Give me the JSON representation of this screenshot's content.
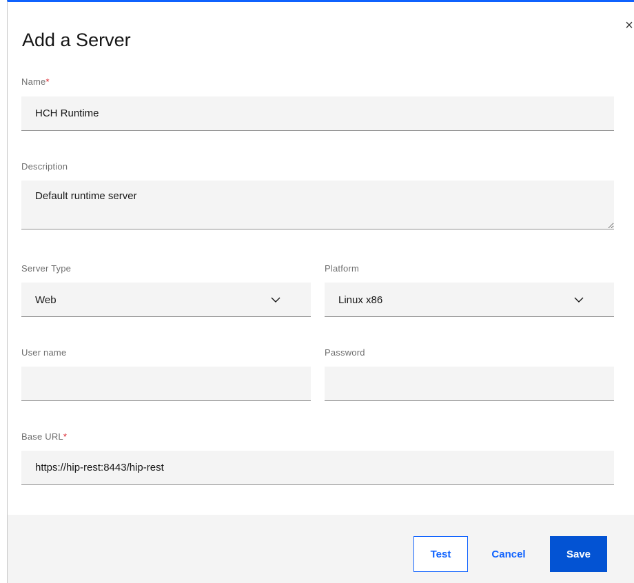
{
  "dialog": {
    "title": "Add a Server",
    "close_glyph": "×"
  },
  "fields": {
    "name": {
      "label": "Name",
      "required_mark": "*",
      "value": "HCH Runtime"
    },
    "description": {
      "label": "Description",
      "value": "Default runtime server"
    },
    "server_type": {
      "label": "Server Type",
      "value": "Web"
    },
    "platform": {
      "label": "Platform",
      "value": "Linux x86"
    },
    "username": {
      "label": "User name",
      "value": ""
    },
    "password": {
      "label": "Password",
      "value": ""
    },
    "base_url": {
      "label": "Base URL",
      "required_mark": "*",
      "value": "https://hip-rest:8443/hip-rest"
    }
  },
  "footer": {
    "test_label": "Test",
    "cancel_label": "Cancel",
    "save_label": "Save"
  },
  "icons": {
    "close": "close-icon",
    "chevron": "chevron-down-icon"
  },
  "colors": {
    "accent": "#0f62fe",
    "primary_button": "#0353d3",
    "field_bg": "#f4f4f4",
    "required": "#da1e28"
  }
}
